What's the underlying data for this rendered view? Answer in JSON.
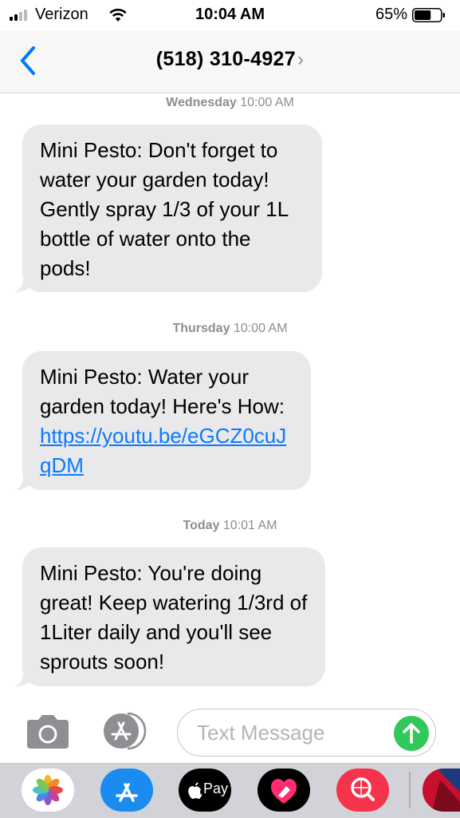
{
  "status_bar": {
    "carrier": "Verizon",
    "time": "10:04 AM",
    "battery_percent": "65%",
    "battery_level": 0.65
  },
  "nav": {
    "contact": "(518) 310-4927",
    "back_icon": "chevron-left-icon",
    "details_icon": "chevron-right-icon"
  },
  "messages": [
    {
      "day": "Wednesday",
      "time": "10:00 AM",
      "text": "Mini Pesto: Don't forget to water your garden today! Gently spray 1/3 of your 1L bottle of water onto the pods!"
    },
    {
      "day": "Thursday",
      "time": "10:00 AM",
      "text": "Mini Pesto: Water your garden today! Here's How: ",
      "link": "https://youtu.be/eGCZ0cuJqDM"
    },
    {
      "day": "Today",
      "time": "10:01 AM",
      "text": "Mini Pesto: You're doing great! Keep watering 1/3rd of 1Liter daily and you'll see sprouts soon!"
    }
  ],
  "composer": {
    "placeholder": "Text Message",
    "camera_icon": "camera-icon",
    "apps_icon": "app-store-icon",
    "send_icon": "send-arrow-icon"
  },
  "dock": {
    "apps": [
      {
        "name": "photos-app-icon"
      },
      {
        "name": "app-store-app-icon"
      },
      {
        "name": "apple-pay-app-icon",
        "label": "Pay"
      },
      {
        "name": "digital-touch-app-icon"
      },
      {
        "name": "images-search-app-icon"
      },
      {
        "name": "partial-app-icon"
      }
    ]
  },
  "colors": {
    "bubble": "#e9e9eb",
    "link": "#0a7aff",
    "accent": "#007aff",
    "send": "#32c759"
  }
}
